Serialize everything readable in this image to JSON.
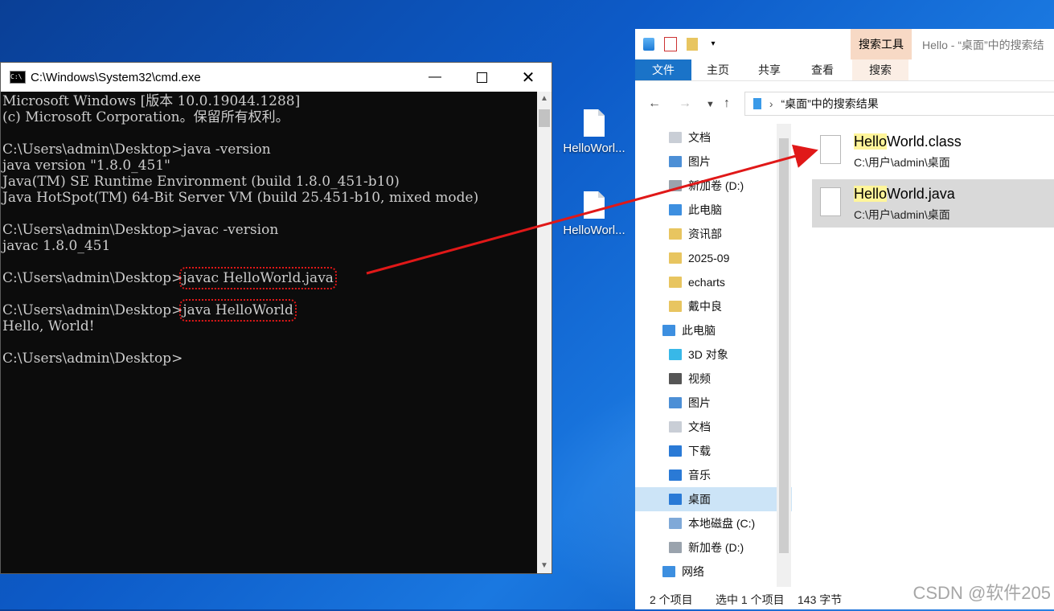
{
  "desktop": {
    "icons": [
      {
        "label": "HelloWorl..."
      },
      {
        "label": "HelloWorl..."
      }
    ]
  },
  "cmd": {
    "title": "C:\\Windows\\System32\\cmd.exe",
    "app_icon_text": "C:\\",
    "lines": [
      "Microsoft Windows [版本 10.0.19044.1288]",
      "(c) Microsoft Corporation。保留所有权利。",
      "",
      "C:\\Users\\admin\\Desktop>java -version",
      "java version \"1.8.0_451\"",
      "Java(TM) SE Runtime Environment (build 1.8.0_451-b10)",
      "Java HotSpot(TM) 64-Bit Server VM (build 25.451-b10, mixed mode)",
      "",
      "C:\\Users\\admin\\Desktop>javac -version",
      "javac 1.8.0_451",
      "",
      "C:\\Users\\admin\\Desktop>",
      "",
      "C:\\Users\\admin\\Desktop>",
      "Hello, World!",
      "",
      "C:\\Users\\admin\\Desktop>"
    ],
    "highlighted_cmd_1": "javac HelloWorld.java",
    "highlighted_cmd_2": "java HelloWorld",
    "annotation_color": "#e01818"
  },
  "explorer": {
    "context_tab": "搜索工具",
    "window_title": "Hello - “桌面”中的搜索结",
    "ribbon_tabs": [
      "文件",
      "主页",
      "共享",
      "查看",
      "搜索"
    ],
    "address": "“桌面”中的搜索结果",
    "nav_items": [
      {
        "label": "文档",
        "pinned": true
      },
      {
        "label": "图片",
        "pinned": true
      },
      {
        "label": "新加卷 (D:)",
        "pinned": true
      },
      {
        "label": "此电脑",
        "pinned": true
      },
      {
        "label": "资讯部",
        "pinned": true
      },
      {
        "label": "2025-09",
        "pinned": false
      },
      {
        "label": "echarts",
        "pinned": false
      },
      {
        "label": "戴中良",
        "pinned": false
      },
      {
        "label": "此电脑",
        "pinned": false
      },
      {
        "label": "3D 对象",
        "pinned": false
      },
      {
        "label": "视频",
        "pinned": false
      },
      {
        "label": "图片",
        "pinned": false
      },
      {
        "label": "文档",
        "pinned": false
      },
      {
        "label": "下载",
        "pinned": false
      },
      {
        "label": "音乐",
        "pinned": false
      },
      {
        "label": "桌面",
        "pinned": false
      },
      {
        "label": "本地磁盘 (C:)",
        "pinned": false
      },
      {
        "label": "新加卷 (D:)",
        "pinned": false
      },
      {
        "label": "网络",
        "pinned": false
      }
    ],
    "results": [
      {
        "match": "Hello",
        "rest": "World.class",
        "path": "C:\\用户\\admin\\桌面"
      },
      {
        "match": "Hello",
        "rest": "World.java",
        "path": "C:\\用户\\admin\\桌面"
      }
    ],
    "status": {
      "count": "2 个项目",
      "selected": "选中 1 个项目",
      "size": "143 字节"
    }
  },
  "watermark": "CSDN @软件205"
}
